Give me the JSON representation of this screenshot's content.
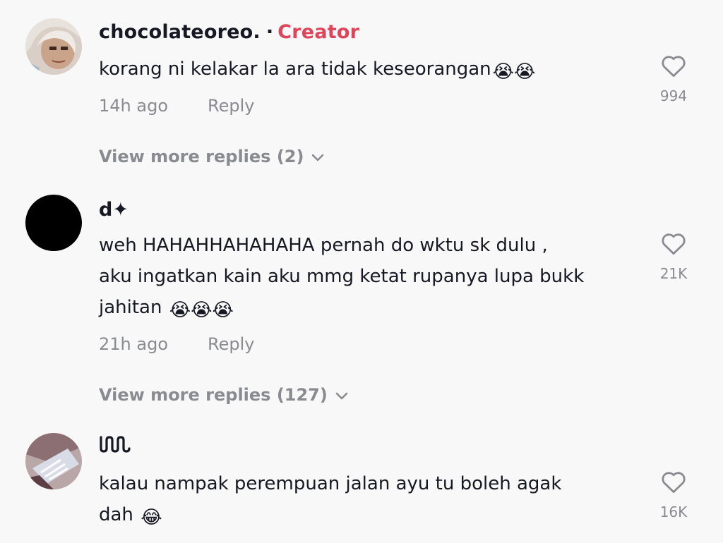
{
  "comments": [
    {
      "username": "chocolateoreo.",
      "separator": "·",
      "creator_label": "Creator",
      "text_lines": [
        "korang ni kelakar la ara tidak keseorangan"
      ],
      "emojis": "😭😭",
      "time": "14h ago",
      "reply_label": "Reply",
      "likes": "994",
      "view_more": "View more replies (2)"
    },
    {
      "username": "d✦",
      "text_lines": [
        "weh HAHAHHAHAHAHA pernah do wktu sk dulu ,",
        "aku ingatkan kain aku mmg ketat rupanya lupa bukk",
        "jahitan "
      ],
      "emojis": "😭😭😭",
      "time": "21h ago",
      "reply_label": "Reply",
      "likes": "21K",
      "view_more": "View more replies (127)"
    },
    {
      "username": "ɯ",
      "text_lines": [
        "kalau nampak perempuan jalan ayu tu boleh agak",
        "dah "
      ],
      "emojis": "😂",
      "likes": "16K"
    }
  ],
  "colors": {
    "background": "#f8f8f8",
    "text": "#161823",
    "muted": "#8a8b91",
    "creator": "#e0445b"
  },
  "icons": [
    "heart-outline-icon",
    "chevron-down-icon",
    "crying-face-emoji",
    "tears-of-joy-emoji"
  ]
}
